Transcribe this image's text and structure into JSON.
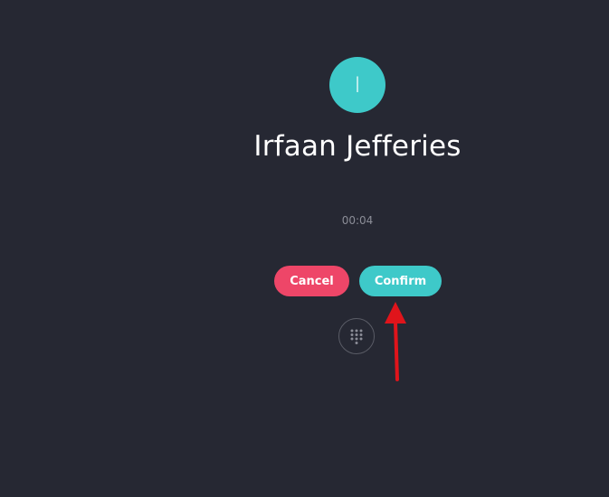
{
  "contact": {
    "initial": "I",
    "name": "Irfaan Jefferies"
  },
  "call": {
    "timer": "00:04"
  },
  "actions": {
    "cancel_label": "Cancel",
    "confirm_label": "Confirm"
  },
  "icons": {
    "dialpad": "dialpad-icon",
    "annotation": "red-arrow-annotation"
  },
  "colors": {
    "background": "#262833",
    "accent_teal": "#3ec9c9",
    "cancel_red": "#ee4668",
    "timer_gray": "#8b8d97",
    "annotation_red": "#e0141b"
  }
}
